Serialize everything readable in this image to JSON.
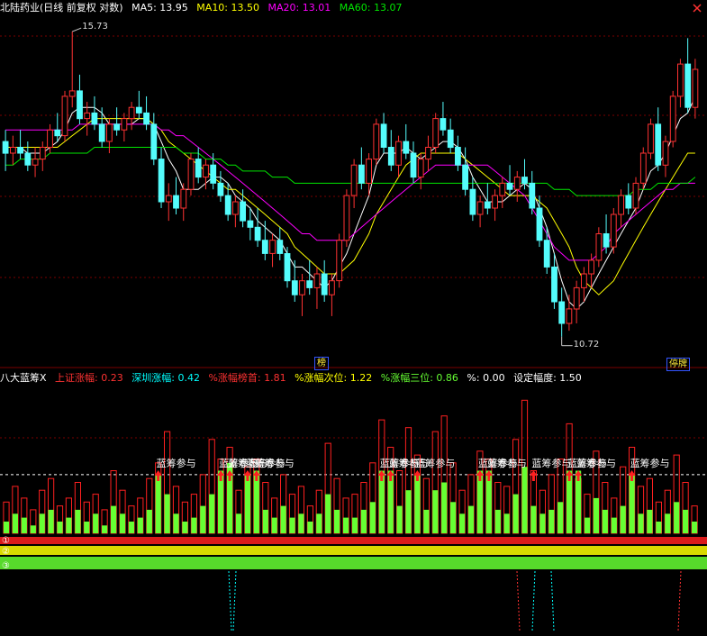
{
  "header": {
    "title": "北陆药业(日线 前复权 对数)",
    "ma5": "MA5: 13.95",
    "ma10": "MA10: 13.50",
    "ma20": "MA20: 13.01",
    "ma60": "MA60: 13.07"
  },
  "price_labels": {
    "high": "15.73",
    "low": "10.72"
  },
  "badges": {
    "rank": "榜",
    "flag": "停牌"
  },
  "indicator": {
    "name": "八大蓝筹X",
    "sh_change": "上证涨幅: 0.23",
    "sz_change": "深圳涨幅: 0.42",
    "top1": "%涨幅榜首: 1.81",
    "top2": "%涨幅次位: 1.22",
    "top3": "%涨幅三位: 0.86",
    "pct": "%: 0.00",
    "setting": "设定幅度: 1.50",
    "signal_text": "蓝筹参与",
    "row_labels": [
      "①",
      "②",
      "③"
    ]
  },
  "colors": {
    "up": "#ff3232",
    "down": "#54fcfc",
    "ma5": "#ffffff",
    "ma10": "#ffff00",
    "ma20": "#ff00ff",
    "ma60": "#00e600",
    "bar_green": "#66ff33",
    "bar_red": "#ff2020",
    "bar_yellow": "#ffff00",
    "grid": "#7a0000",
    "text_white": "#ffffff",
    "text_cyan": "#00ffff"
  },
  "icons": {
    "close": "x-icon"
  },
  "chart_data": [
    {
      "type": "candlestick",
      "title": "北陆药业(日线 前复权 对数)",
      "xlabel": "",
      "ylabel": "",
      "ylim": [
        10.5,
        16.0
      ],
      "grid": true,
      "candles": [
        [
          13.7,
          13.9,
          13.2,
          13.5
        ],
        [
          13.5,
          13.8,
          13.3,
          13.6
        ],
        [
          13.6,
          13.9,
          13.4,
          13.5
        ],
        [
          13.5,
          13.7,
          13.2,
          13.3
        ],
        [
          13.3,
          13.6,
          13.1,
          13.4
        ],
        [
          13.4,
          13.7,
          13.2,
          13.6
        ],
        [
          13.6,
          14.0,
          13.5,
          13.9
        ],
        [
          13.9,
          14.2,
          13.7,
          13.8
        ],
        [
          13.8,
          14.6,
          13.7,
          14.5
        ],
        [
          14.5,
          15.73,
          14.3,
          14.6
        ],
        [
          14.6,
          14.9,
          14.0,
          14.1
        ],
        [
          14.1,
          14.4,
          13.8,
          14.2
        ],
        [
          14.2,
          14.5,
          13.9,
          14.0
        ],
        [
          14.0,
          14.3,
          13.6,
          13.7
        ],
        [
          13.7,
          14.1,
          13.5,
          14.0
        ],
        [
          14.0,
          14.3,
          13.8,
          13.9
        ],
        [
          13.9,
          14.2,
          13.7,
          14.1
        ],
        [
          14.1,
          14.4,
          13.9,
          14.3
        ],
        [
          14.3,
          14.6,
          14.1,
          14.2
        ],
        [
          14.2,
          14.5,
          13.9,
          14.0
        ],
        [
          14.0,
          14.2,
          13.3,
          13.4
        ],
        [
          13.4,
          13.6,
          12.6,
          12.7
        ],
        [
          12.7,
          13.0,
          12.4,
          12.8
        ],
        [
          12.8,
          13.1,
          12.5,
          12.6
        ],
        [
          12.6,
          13.0,
          12.4,
          12.9
        ],
        [
          12.9,
          13.5,
          12.8,
          13.4
        ],
        [
          13.4,
          13.6,
          13.0,
          13.1
        ],
        [
          13.1,
          13.4,
          12.9,
          13.3
        ],
        [
          13.3,
          13.5,
          12.9,
          13.0
        ],
        [
          13.0,
          13.2,
          12.7,
          12.8
        ],
        [
          12.8,
          13.0,
          12.4,
          12.5
        ],
        [
          12.5,
          12.8,
          12.3,
          12.7
        ],
        [
          12.7,
          12.9,
          12.3,
          12.4
        ],
        [
          12.4,
          12.6,
          12.1,
          12.3
        ],
        [
          12.3,
          12.6,
          12.0,
          12.1
        ],
        [
          12.1,
          12.4,
          11.8,
          11.9
        ],
        [
          11.9,
          12.2,
          11.7,
          12.1
        ],
        [
          12.1,
          12.3,
          11.8,
          11.9
        ],
        [
          11.9,
          12.0,
          11.4,
          11.5
        ],
        [
          11.5,
          11.8,
          11.2,
          11.3
        ],
        [
          11.3,
          11.6,
          11.0,
          11.5
        ],
        [
          11.5,
          11.8,
          11.3,
          11.4
        ],
        [
          11.4,
          11.7,
          11.1,
          11.6
        ],
        [
          11.6,
          11.8,
          11.2,
          11.3
        ],
        [
          11.3,
          11.6,
          11.0,
          11.5
        ],
        [
          11.5,
          12.2,
          11.4,
          12.1
        ],
        [
          12.1,
          12.9,
          12.0,
          12.8
        ],
        [
          12.8,
          13.4,
          12.6,
          13.3
        ],
        [
          13.3,
          13.6,
          12.9,
          13.0
        ],
        [
          13.0,
          13.5,
          12.8,
          13.4
        ],
        [
          13.4,
          14.1,
          13.3,
          14.0
        ],
        [
          14.0,
          14.2,
          13.5,
          13.6
        ],
        [
          13.6,
          13.9,
          13.2,
          13.3
        ],
        [
          13.3,
          13.8,
          13.1,
          13.7
        ],
        [
          13.7,
          14.0,
          13.4,
          13.5
        ],
        [
          13.5,
          13.7,
          13.0,
          13.1
        ],
        [
          13.1,
          13.5,
          12.9,
          13.4
        ],
        [
          13.4,
          13.8,
          13.2,
          13.6
        ],
        [
          13.6,
          14.2,
          13.5,
          14.1
        ],
        [
          14.1,
          14.4,
          13.8,
          13.9
        ],
        [
          13.9,
          14.1,
          13.5,
          13.6
        ],
        [
          13.6,
          13.8,
          13.2,
          13.3
        ],
        [
          13.3,
          13.6,
          12.8,
          12.9
        ],
        [
          12.9,
          13.1,
          12.4,
          12.5
        ],
        [
          12.5,
          12.8,
          12.3,
          12.7
        ],
        [
          12.7,
          13.0,
          12.5,
          12.6
        ],
        [
          12.6,
          12.9,
          12.4,
          12.8
        ],
        [
          12.8,
          13.1,
          12.6,
          13.0
        ],
        [
          13.0,
          13.3,
          12.8,
          12.9
        ],
        [
          12.9,
          13.2,
          12.7,
          13.1
        ],
        [
          13.1,
          13.4,
          12.9,
          13.0
        ],
        [
          13.0,
          13.2,
          12.5,
          12.6
        ],
        [
          12.6,
          12.8,
          12.0,
          12.1
        ],
        [
          12.1,
          12.3,
          11.6,
          11.7
        ],
        [
          11.7,
          11.9,
          11.1,
          11.2
        ],
        [
          11.2,
          11.4,
          10.72,
          10.9
        ],
        [
          10.9,
          11.3,
          10.8,
          11.1
        ],
        [
          11.1,
          11.5,
          10.9,
          11.4
        ],
        [
          11.4,
          11.7,
          11.2,
          11.6
        ],
        [
          11.6,
          11.9,
          11.4,
          11.8
        ],
        [
          11.8,
          12.3,
          11.7,
          12.2
        ],
        [
          12.2,
          12.5,
          11.9,
          12.0
        ],
        [
          12.0,
          12.6,
          11.9,
          12.5
        ],
        [
          12.5,
          12.9,
          12.3,
          12.8
        ],
        [
          12.8,
          13.0,
          12.5,
          12.6
        ],
        [
          12.6,
          13.1,
          12.5,
          13.0
        ],
        [
          13.0,
          13.6,
          12.9,
          13.5
        ],
        [
          13.5,
          14.1,
          13.4,
          14.0
        ],
        [
          14.0,
          14.3,
          13.2,
          13.3
        ],
        [
          13.3,
          13.8,
          13.1,
          13.7
        ],
        [
          13.7,
          14.6,
          13.6,
          14.5
        ],
        [
          14.5,
          15.2,
          14.3,
          15.1
        ],
        [
          15.1,
          15.6,
          14.2,
          14.3
        ],
        [
          14.3,
          15.2,
          14.1,
          15.0
        ]
      ],
      "series": [
        {
          "name": "MA5",
          "values": [
            13.6,
            13.6,
            13.6,
            13.5,
            13.5,
            13.5,
            13.6,
            13.7,
            13.9,
            14.2,
            14.3,
            14.3,
            14.3,
            14.2,
            14.0,
            14.0,
            14.0,
            14.0,
            14.1,
            14.1,
            14.0,
            13.7,
            13.4,
            13.2,
            12.9,
            12.9,
            12.9,
            13.0,
            13.1,
            13.1,
            13.0,
            12.8,
            12.7,
            12.6,
            12.4,
            12.3,
            12.2,
            12.1,
            11.9,
            11.7,
            11.7,
            11.6,
            11.5,
            11.4,
            11.5,
            11.7,
            11.9,
            12.2,
            12.5,
            12.8,
            13.3,
            13.5,
            13.5,
            13.5,
            13.6,
            13.5,
            13.4,
            13.5,
            13.6,
            13.7,
            13.7,
            13.6,
            13.4,
            13.1,
            12.9,
            12.7,
            12.7,
            12.7,
            12.8,
            12.9,
            13.0,
            12.9,
            12.6,
            12.3,
            11.9,
            11.5,
            11.2,
            11.1,
            11.2,
            11.4,
            11.6,
            11.8,
            12.0,
            12.2,
            12.4,
            12.6,
            12.9,
            13.2,
            13.3,
            13.5,
            13.8,
            14.1,
            14.2,
            14.5
          ]
        },
        {
          "name": "MA10",
          "values": [
            13.6,
            13.6,
            13.6,
            13.6,
            13.6,
            13.6,
            13.6,
            13.6,
            13.7,
            13.8,
            13.9,
            14.0,
            14.1,
            14.1,
            14.1,
            14.1,
            14.1,
            14.1,
            14.1,
            14.1,
            14.0,
            13.9,
            13.7,
            13.6,
            13.5,
            13.4,
            13.3,
            13.2,
            13.1,
            13.0,
            12.9,
            12.9,
            12.8,
            12.7,
            12.6,
            12.5,
            12.4,
            12.3,
            12.2,
            12.0,
            11.9,
            11.8,
            11.7,
            11.6,
            11.6,
            11.6,
            11.7,
            11.8,
            12.0,
            12.2,
            12.5,
            12.7,
            12.9,
            13.1,
            13.3,
            13.4,
            13.5,
            13.5,
            13.5,
            13.5,
            13.5,
            13.5,
            13.4,
            13.3,
            13.2,
            13.1,
            13.0,
            12.9,
            12.8,
            12.8,
            12.8,
            12.8,
            12.7,
            12.6,
            12.4,
            12.2,
            12.0,
            11.7,
            11.5,
            11.4,
            11.3,
            11.4,
            11.5,
            11.7,
            11.9,
            12.1,
            12.3,
            12.5,
            12.7,
            12.9,
            13.1,
            13.3,
            13.5,
            13.5
          ]
        },
        {
          "name": "MA20",
          "values": [
            13.9,
            13.9,
            13.9,
            13.9,
            13.9,
            13.9,
            13.9,
            13.9,
            13.9,
            13.9,
            14.0,
            14.0,
            14.0,
            14.0,
            14.0,
            14.0,
            14.0,
            14.0,
            14.0,
            14.0,
            14.0,
            13.9,
            13.9,
            13.8,
            13.8,
            13.7,
            13.6,
            13.5,
            13.4,
            13.3,
            13.2,
            13.1,
            13.0,
            12.9,
            12.8,
            12.7,
            12.6,
            12.5,
            12.4,
            12.3,
            12.2,
            12.2,
            12.1,
            12.1,
            12.1,
            12.1,
            12.1,
            12.2,
            12.3,
            12.4,
            12.5,
            12.6,
            12.7,
            12.8,
            12.9,
            13.0,
            13.1,
            13.2,
            13.3,
            13.3,
            13.3,
            13.3,
            13.3,
            13.3,
            13.3,
            13.3,
            13.2,
            13.1,
            13.0,
            12.9,
            12.8,
            12.6,
            12.4,
            12.2,
            12.0,
            11.9,
            11.8,
            11.8,
            11.8,
            11.8,
            11.9,
            12.0,
            12.2,
            12.3,
            12.4,
            12.5,
            12.6,
            12.7,
            12.8,
            12.9,
            12.9,
            13.0,
            13.0,
            13.0
          ]
        },
        {
          "name": "MA60",
          "values": [
            13.3,
            13.3,
            13.4,
            13.4,
            13.4,
            13.4,
            13.5,
            13.5,
            13.5,
            13.5,
            13.5,
            13.5,
            13.6,
            13.6,
            13.6,
            13.6,
            13.6,
            13.6,
            13.6,
            13.6,
            13.6,
            13.6,
            13.6,
            13.6,
            13.5,
            13.5,
            13.5,
            13.4,
            13.4,
            13.4,
            13.3,
            13.3,
            13.2,
            13.2,
            13.2,
            13.2,
            13.1,
            13.1,
            13.1,
            13.0,
            13.0,
            13.0,
            13.0,
            13.0,
            13.0,
            13.0,
            13.0,
            13.0,
            13.0,
            13.0,
            13.0,
            13.0,
            13.0,
            13.0,
            13.0,
            13.0,
            13.0,
            13.0,
            13.0,
            13.0,
            13.0,
            13.0,
            13.0,
            13.0,
            13.0,
            13.0,
            13.0,
            13.0,
            13.0,
            13.0,
            13.0,
            13.0,
            13.0,
            13.0,
            12.9,
            12.9,
            12.9,
            12.8,
            12.8,
            12.8,
            12.8,
            12.8,
            12.8,
            12.8,
            12.8,
            12.9,
            12.9,
            12.9,
            13.0,
            13.0,
            13.0,
            13.0,
            13.0,
            13.1
          ]
        }
      ]
    },
    {
      "type": "bar",
      "title": "八大蓝筹X",
      "xlabel": "",
      "ylabel": "",
      "ylim": [
        0,
        3.5
      ],
      "threshold": 1.5,
      "signal_positions": [
        17,
        24,
        25,
        27,
        28,
        42,
        43,
        46,
        53,
        54,
        59,
        63,
        64,
        70
      ],
      "red_outline_values": [
        0.8,
        1.2,
        0.9,
        0.6,
        1.1,
        1.4,
        0.7,
        0.9,
        1.3,
        0.8,
        1.0,
        0.6,
        1.6,
        1.1,
        0.7,
        0.9,
        1.4,
        1.8,
        2.6,
        1.2,
        0.8,
        1.0,
        1.5,
        2.4,
        1.9,
        2.2,
        1.1,
        1.7,
        1.9,
        1.3,
        0.9,
        1.5,
        1.0,
        1.2,
        0.7,
        1.1,
        2.3,
        1.4,
        0.9,
        1.0,
        1.3,
        1.8,
        2.9,
        2.2,
        1.6,
        2.7,
        2.0,
        1.4,
        2.6,
        3.0,
        1.8,
        1.1,
        1.5,
        2.1,
        1.9,
        1.3,
        1.2,
        2.4,
        3.4,
        1.6,
        1.1,
        1.5,
        1.9,
        2.8,
        1.4,
        1.0,
        2.1,
        1.3,
        0.9,
        1.7,
        2.2,
        1.2,
        1.4,
        0.8,
        1.1,
        2.0,
        1.3,
        0.7
      ],
      "green_values": [
        0.3,
        0.5,
        0.4,
        0.2,
        0.5,
        0.6,
        0.3,
        0.4,
        0.6,
        0.3,
        0.5,
        0.2,
        0.7,
        0.5,
        0.3,
        0.4,
        0.6,
        1.5,
        1.0,
        0.5,
        0.3,
        0.4,
        0.7,
        1.0,
        1.6,
        1.8,
        0.5,
        1.5,
        1.6,
        0.6,
        0.4,
        0.7,
        0.4,
        0.5,
        0.3,
        0.5,
        1.0,
        0.6,
        0.4,
        0.4,
        0.6,
        0.8,
        1.6,
        1.6,
        0.7,
        1.1,
        1.5,
        0.6,
        1.1,
        1.3,
        0.8,
        0.5,
        0.7,
        1.6,
        1.6,
        0.6,
        0.5,
        1.0,
        1.7,
        0.7,
        0.5,
        0.6,
        0.8,
        1.6,
        1.6,
        0.4,
        0.9,
        0.6,
        0.4,
        0.7,
        1.5,
        0.5,
        0.6,
        0.3,
        0.5,
        0.8,
        0.6,
        0.3
      ]
    }
  ]
}
